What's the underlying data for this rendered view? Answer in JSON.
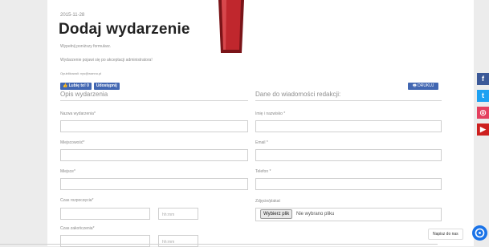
{
  "header": {
    "date": "2015-11-28",
    "title": "Dodaj wydarzenie",
    "hint1": "Wypełnij poniższy formularz.",
    "hint2": "Wydarzenie pojawi się po akceptacji administratora!",
    "contact": "Opublikowali: nys@wanno.pl"
  },
  "social_buttons": {
    "like": "Lubię to! 0",
    "share": "Udostępnij"
  },
  "print_button": "DRUKUJ",
  "left_section": {
    "heading": "Opis wydarzenia",
    "name_label": "Nazwa wydarzenia*",
    "city_label": "Miejscowość*",
    "place_label": "Miejsce*",
    "start_label": "Czas rozpoczęcia*",
    "start_time_placeholder": "hh:mm",
    "end_label": "Czas zakończenia*",
    "end_time_placeholder": "hh:mm"
  },
  "right_section": {
    "heading": "Dane do wiadomości redakcji:",
    "fullname_label": "Imię i nazwisko *",
    "email_label": "Email *",
    "phone_label": "Telefon *",
    "photo_label": "Zdjęcie/plakat",
    "file_button": "Wybierz plik",
    "file_status": "Nie wybrano pliku"
  },
  "side_social": [
    {
      "name": "facebook-icon",
      "glyph": "f",
      "color": "#3b5998"
    },
    {
      "name": "twitter-icon",
      "glyph": "t",
      "color": "#1da1f2"
    },
    {
      "name": "instagram-icon",
      "glyph": "◎",
      "color": "#e4405f"
    },
    {
      "name": "youtube-icon",
      "glyph": "▶",
      "color": "#cd201f"
    }
  ],
  "chat": {
    "label": "Napisz do nas"
  },
  "colors": {
    "accent": "#4267b2",
    "marker": "#c0272d"
  }
}
